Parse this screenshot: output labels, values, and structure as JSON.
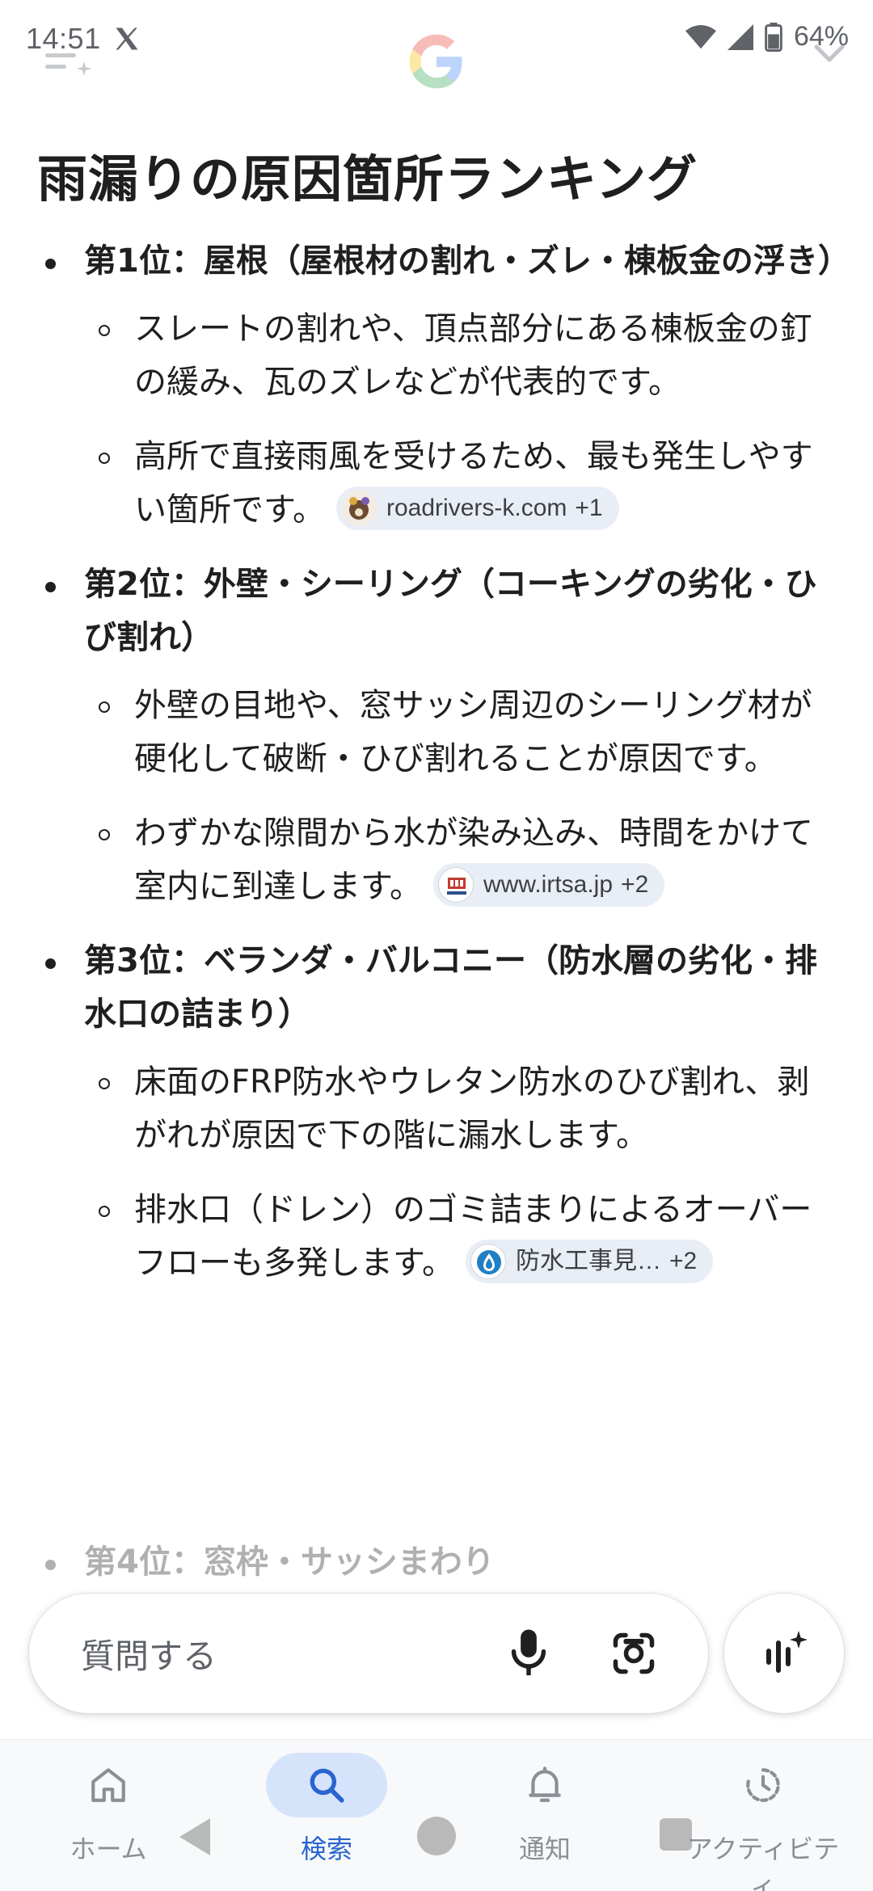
{
  "status_bar": {
    "time": "14:51",
    "battery": "64%"
  },
  "page_title": "雨漏りの原因箇所ランキング",
  "ranks": [
    {
      "heading": "第1位：屋根（屋根材の割れ・ズレ・棟板金の浮き）",
      "points": [
        {
          "text": "スレートの割れや、頂点部分にある棟板金の釘の緩み、瓦のズレなどが代表的です。"
        },
        {
          "text": "高所で直接雨風を受けるため、最も発生しやすい箇所です。",
          "source": {
            "label": "roadrivers-k.com",
            "extra": "+1",
            "icon": "roadrivers-site-icon"
          }
        }
      ]
    },
    {
      "heading": "第2位：外壁・シーリング（コーキングの劣化・ひび割れ）",
      "points": [
        {
          "text": "外壁の目地や、窓サッシ周辺のシーリング材が硬化して破断・ひび割れることが原因です。"
        },
        {
          "text": "わずかな隙間から水が染み込み、時間をかけて室内に到達します。",
          "source": {
            "label": "www.irtsa.jp",
            "extra": "+2",
            "icon": "irtsa-site-icon"
          }
        }
      ]
    },
    {
      "heading": "第3位：ベランダ・バルコニー（防水層の劣化・排水口の詰まり）",
      "points": [
        {
          "text": "床面のFRP防水やウレタン防水のひび割れ、剥がれが原因で下の階に漏水します。"
        },
        {
          "text": "排水口（ドレン）のゴミ詰まりによるオーバーフローも多発します。",
          "source": {
            "label": "防水工事見…",
            "extra": "+2",
            "icon": "waterproof-drop-icon"
          }
        }
      ]
    }
  ],
  "partial_rank_heading": "第4位：窓枠・サッシまわり",
  "ask_bar": {
    "placeholder": "質問する"
  },
  "bottom_nav": [
    {
      "label": "ホーム",
      "icon": "home-icon",
      "active": false
    },
    {
      "label": "検索",
      "icon": "search-icon",
      "active": true
    },
    {
      "label": "通知",
      "icon": "bell-icon",
      "active": false
    },
    {
      "label": "アクティビティ",
      "icon": "activity-icon",
      "active": false
    }
  ],
  "colors": {
    "accent": "#2a64d0",
    "chip_bg": "#e9eef6",
    "nav_active_bg": "#d6e4fb",
    "text": "#1f1f1f"
  }
}
